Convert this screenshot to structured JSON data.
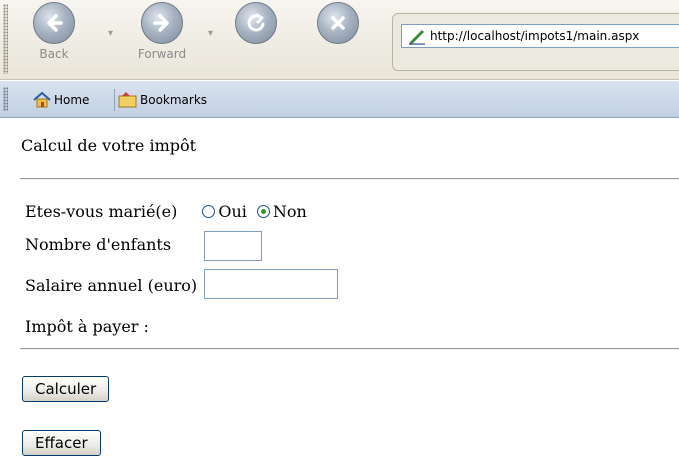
{
  "browser": {
    "back_label": "Back",
    "forward_label": "Forward",
    "address": "http://localhost/impots1/main.aspx",
    "bookmarks_bar": {
      "home_label": "Home",
      "bookmarks_label": "Bookmarks"
    }
  },
  "page": {
    "title": "Calcul de votre impôt",
    "married": {
      "label": "Etes-vous marié(e)",
      "options": [
        "Oui",
        "Non"
      ],
      "selected": "Non"
    },
    "children": {
      "label": "Nombre d'enfants",
      "value": ""
    },
    "salary": {
      "label": "Salaire annuel (euro)",
      "value": ""
    },
    "tax": {
      "label": "Impôt à payer :",
      "value": ""
    },
    "buttons": {
      "calculate": "Calculer",
      "clear": "Effacer"
    }
  }
}
